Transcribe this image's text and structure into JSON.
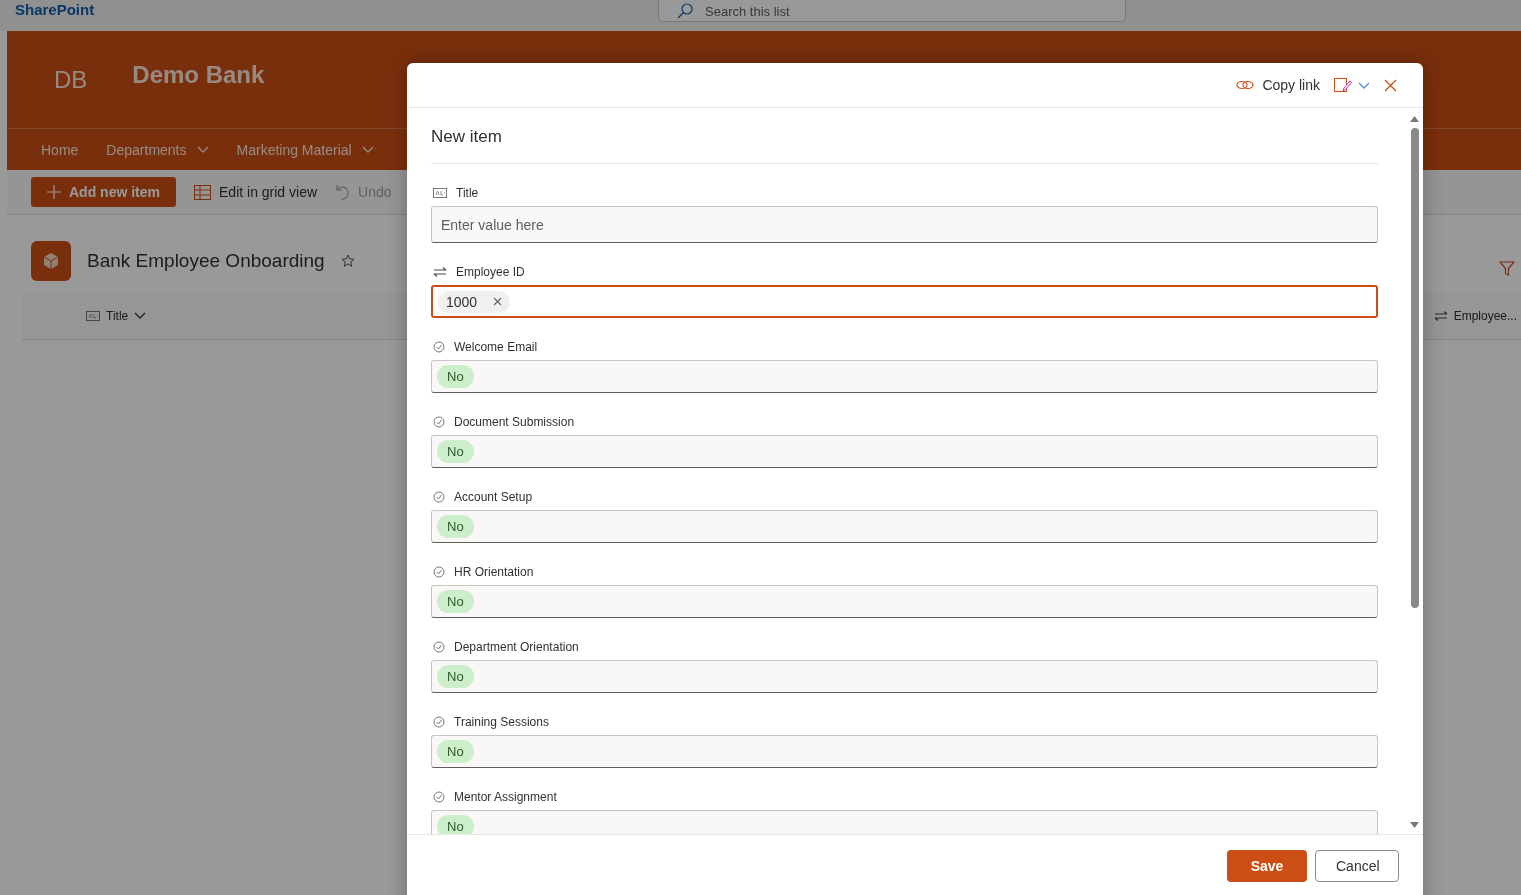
{
  "app": {
    "name": "SharePoint",
    "search": {
      "placeholder": "Search this list"
    }
  },
  "site": {
    "initials": "DB",
    "title": "Demo Bank",
    "nav": [
      {
        "label": "Home",
        "dropdown": false
      },
      {
        "label": "Departments",
        "dropdown": true
      },
      {
        "label": "Marketing Material",
        "dropdown": true
      }
    ]
  },
  "command_bar": [
    {
      "label": "Add new item",
      "kind": "primary",
      "disabled": false
    },
    {
      "label": "Edit in grid view",
      "kind": "grid",
      "disabled": false
    },
    {
      "label": "Undo",
      "kind": "undo",
      "disabled": true
    }
  ],
  "list": {
    "title": "Bank Employee Onboarding",
    "favorite": false,
    "columns": [
      {
        "label": "Title",
        "kind": "text"
      },
      {
        "label": "Employee...",
        "kind": "number"
      }
    ]
  },
  "panel": {
    "copy_link": "Copy link",
    "title": "New item",
    "fields": [
      {
        "label": "Title",
        "kind": "text",
        "placeholder": "Enter value here"
      },
      {
        "label": "Employee ID",
        "kind": "number",
        "value": "1000",
        "focused": true
      },
      {
        "label": "Welcome Email",
        "kind": "yesno",
        "value": "No"
      },
      {
        "label": "Document Submission",
        "kind": "yesno",
        "value": "No"
      },
      {
        "label": "Account Setup",
        "kind": "yesno",
        "value": "No"
      },
      {
        "label": "HR Orientation",
        "kind": "yesno",
        "value": "No"
      },
      {
        "label": "Department Orientation",
        "kind": "yesno",
        "value": "No"
      },
      {
        "label": "Training Sessions",
        "kind": "yesno",
        "value": "No"
      },
      {
        "label": "Mentor Assignment",
        "kind": "yesno",
        "value": "No"
      }
    ],
    "buttons": [
      {
        "label": "Save",
        "kind": "primary"
      },
      {
        "label": "Cancel",
        "kind": "default"
      }
    ]
  }
}
